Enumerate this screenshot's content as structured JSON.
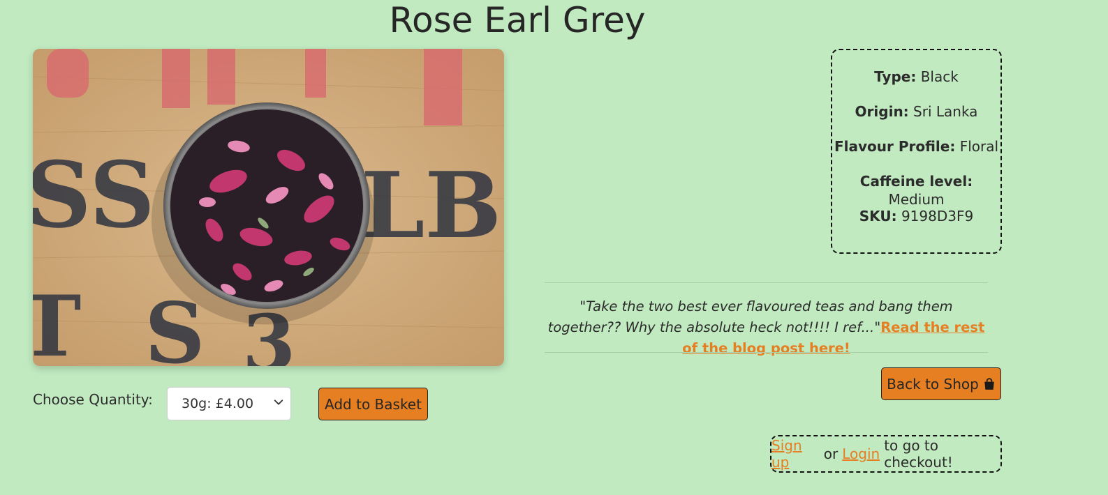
{
  "product": {
    "title": "Rose Earl Grey",
    "image_alt": "Bowl of loose leaf black tea with rose petals on a wooden crate"
  },
  "purchase": {
    "quantity_label": "Choose Quantity:",
    "quantity_selected": "30g: £4.00",
    "add_button": "Add to Basket"
  },
  "details": [
    {
      "label": "Type:",
      "value": "Black"
    },
    {
      "label": "Origin:",
      "value": "Sri Lanka"
    },
    {
      "label": "Flavour Profile:",
      "value": "Floral"
    },
    {
      "label": "Caffeine level:",
      "value": "Medium"
    },
    {
      "label": "SKU:",
      "value": "9198D3F9"
    }
  ],
  "blog": {
    "excerpt": "\"Take the two best ever flavoured teas and bang them together?? Why the absolute heck not!!!! I ref...\"",
    "link_text": "Read the rest of the blog post here!"
  },
  "nav": {
    "back_button": "Back to Shop",
    "back_icon": "shopping-bag-icon"
  },
  "checkout": {
    "signup_link": "Sign up",
    "or_text": "or",
    "login_link": "Login",
    "suffix": "to go to checkout!"
  },
  "colors": {
    "background": "#c1eac1",
    "accent": "#e67e22",
    "text": "#2b2b2b"
  }
}
